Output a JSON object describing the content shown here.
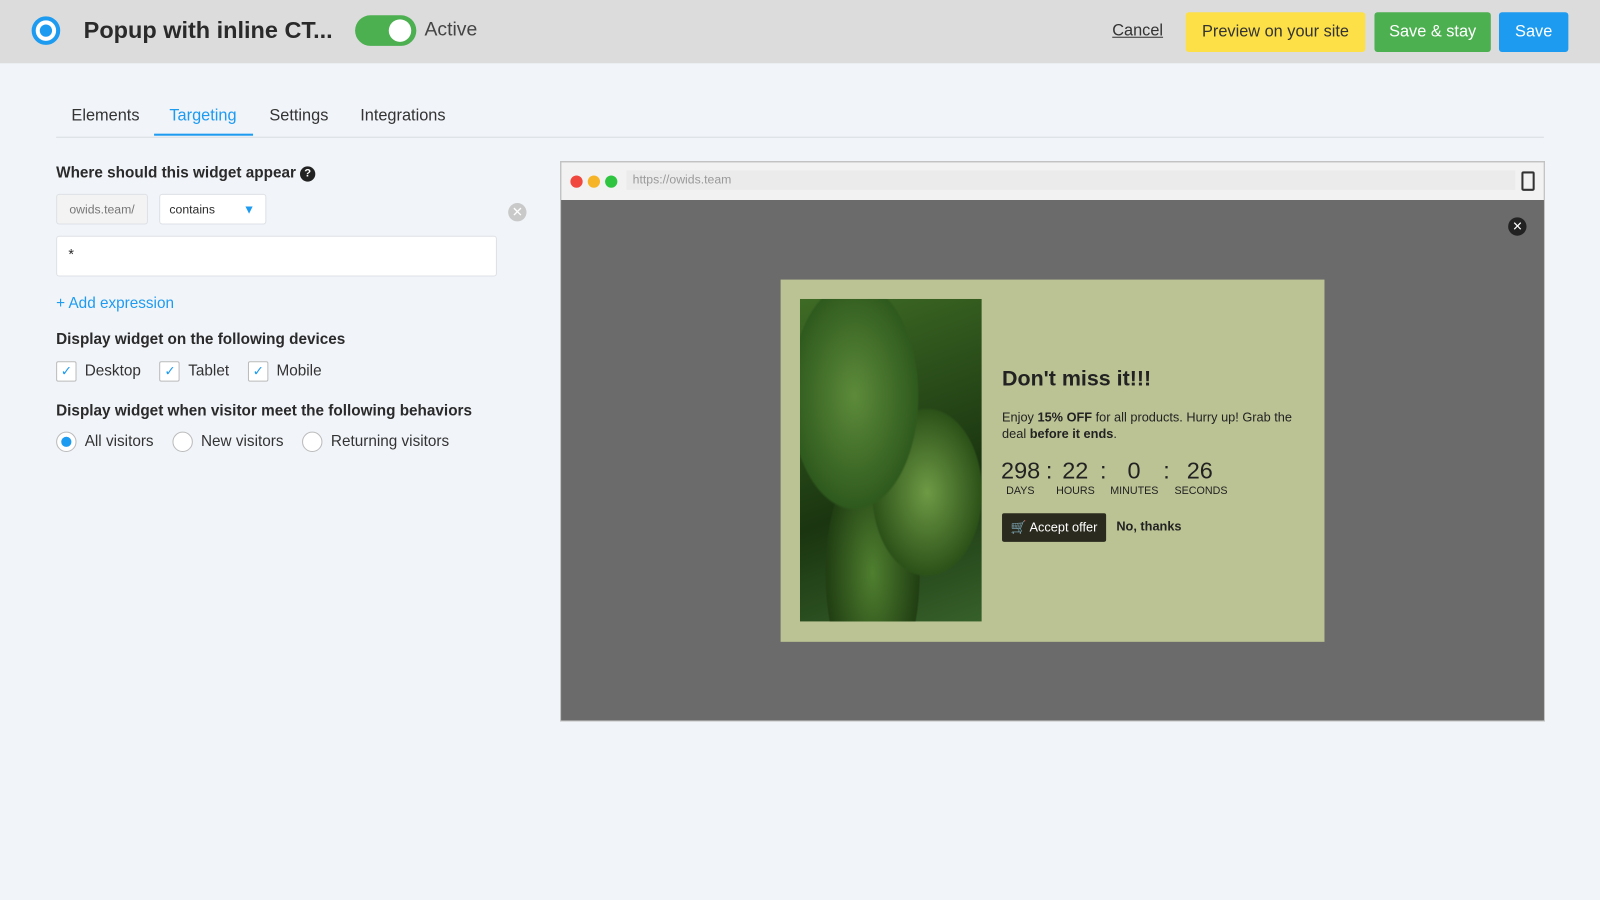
{
  "header": {
    "title": "Popup with inline CT...",
    "status": "Active",
    "cancel": "Cancel",
    "preview": "Preview on your site",
    "save_stay": "Save & stay",
    "save": "Save"
  },
  "tabs": [
    "Elements",
    "Targeting",
    "Settings",
    "Integrations"
  ],
  "targeting": {
    "where_heading": "Where should this widget appear",
    "domain": "owids.team/",
    "match_type": "contains",
    "expression": "*",
    "add_expression": "+ Add expression",
    "devices_heading": "Display widget on the following devices",
    "devices": [
      "Desktop",
      "Tablet",
      "Mobile"
    ],
    "behaviors_heading": "Display widget when visitor meet the following behaviors",
    "visitors": [
      "All visitors",
      "New visitors",
      "Returning visitors"
    ],
    "selected_visitor": "All visitors"
  },
  "preview": {
    "url": "https://owids.team",
    "popup": {
      "title": "Don't miss it!!!",
      "text_1": "Enjoy ",
      "text_bold_1": "15% OFF",
      "text_2": " for all products. Hurry up! Grab the deal ",
      "text_bold_2": "before it ends",
      "text_3": ".",
      "countdown": {
        "days": "298",
        "hours": "22",
        "minutes": "0",
        "seconds": "26"
      },
      "labels": {
        "days": "DAYS",
        "hours": "HOURS",
        "minutes": "MINUTES",
        "seconds": "SECONDS"
      },
      "accept": "Accept offer",
      "decline": "No, thanks"
    }
  },
  "colors": {
    "accent": "#1d9bf0",
    "green": "#4caf50",
    "yellow": "#fde047",
    "popup_bg": "#bbc394"
  }
}
